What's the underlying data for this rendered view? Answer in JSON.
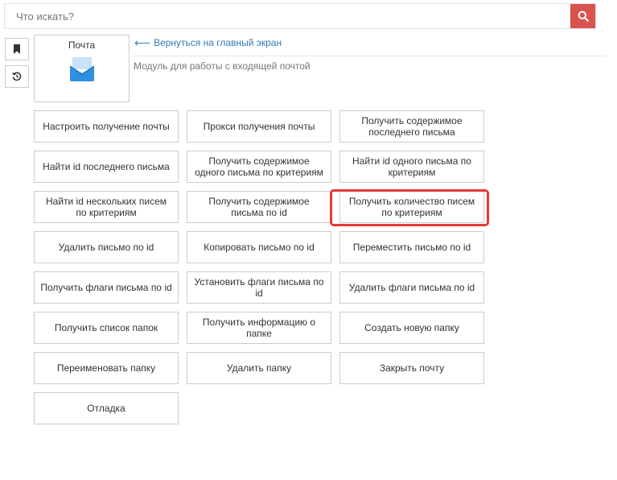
{
  "search": {
    "placeholder": "Что искать?"
  },
  "module": {
    "title": "Почта",
    "back_link": "Вернуться на главный экран",
    "description": "Модуль для работы с входящей почтой"
  },
  "actions": [
    "Настроить получение почты",
    "Прокси получения почты",
    "Получить содержимое последнего письма",
    "Найти id последнего письма",
    "Получить содержимое одного письма по критериям",
    "Найти id одного письма по критериям",
    "Найти id нескольких писем по критериям",
    "Получить содержимое письма по id",
    "Получить количество писем по критериям",
    "Удалить письмо по id",
    "Копировать письмо по id",
    "Переместить письмо по id",
    "Получить флаги письма по id",
    "Установить флаги письма по id",
    "Удалить флаги письма по id",
    "Получить список папок",
    "Получить информацию о папке",
    "Создать новую папку",
    "Переименовать папку",
    "Удалить папку",
    "Закрыть почту",
    "Отладка"
  ],
  "icons": {
    "search": "search-icon",
    "bookmark": "bookmark-icon",
    "history": "history-icon",
    "mail": "mail-icon",
    "back": "arrow-left-icon"
  },
  "colors": {
    "search_button": "#d9534f",
    "link": "#337ab7",
    "highlight": "#e53935",
    "mail_icon": "#2f8fe0"
  }
}
